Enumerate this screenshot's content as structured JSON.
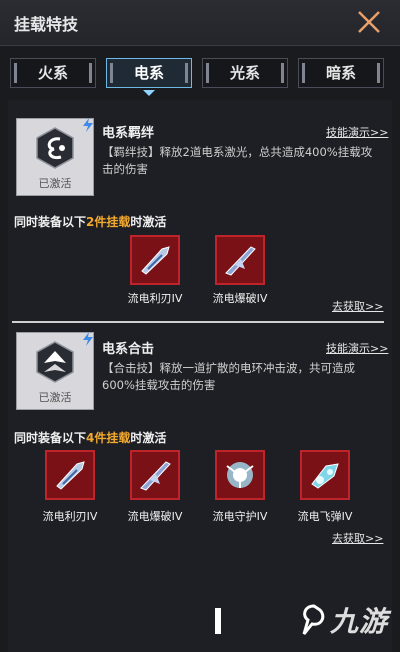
{
  "header": {
    "title": "挂载特技"
  },
  "tabs": [
    {
      "label": "火系"
    },
    {
      "label": "电系"
    },
    {
      "label": "光系"
    },
    {
      "label": "暗系"
    }
  ],
  "active_tab": "电系",
  "skills": [
    {
      "name": "电系羁绊",
      "status": "已激活",
      "demo_link": "技能演示>>",
      "description": "【羁绊技】释放2道电系激光，总共造成400%挂载攻击的伤害",
      "requirement_prefix": "同时装备以下",
      "requirement_highlight": "2件挂载",
      "requirement_suffix": "时激活",
      "items": [
        {
          "label": "流电利刃IV",
          "icon": "blade-pod-icon"
        },
        {
          "label": "流电爆破IV",
          "icon": "blast-pod-icon"
        }
      ],
      "get_link": "去获取>>"
    },
    {
      "name": "电系合击",
      "status": "已激活",
      "demo_link": "技能演示>>",
      "description": "【合击技】释放一道扩散的电环冲击波，共可造成600%挂载攻击的伤害",
      "requirement_prefix": "同时装备以下",
      "requirement_highlight": "4件挂载",
      "requirement_suffix": "时激活",
      "items": [
        {
          "label": "流电利刃IV",
          "icon": "blade-pod-icon"
        },
        {
          "label": "流电爆破IV",
          "icon": "blast-pod-icon"
        },
        {
          "label": "流电守护IV",
          "icon": "guard-orb-icon"
        },
        {
          "label": "流电飞弹IV",
          "icon": "missile-pod-icon"
        }
      ],
      "get_link": "去获取>>"
    }
  ],
  "watermark": "九游",
  "colors": {
    "accent": "#6fb9e6",
    "highlight": "#f1a92e",
    "item_bg": "#7a1116"
  }
}
